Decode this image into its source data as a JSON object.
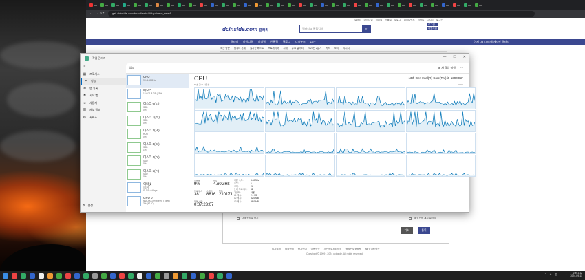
{
  "browser": {
    "url": "gall.dcinside.com/board/write/?id=pridepc_new4",
    "tab_colors": [
      "#e33",
      "#4a4",
      "#3a6",
      "#2a8",
      "#4a4",
      "#3a6",
      "#d84",
      "#4a4",
      "#2a6",
      "#4a4",
      "#e44",
      "#36c",
      "#3a6",
      "#4a4",
      "#36c",
      "#e93",
      "#4a4",
      "#3a6",
      "#4a4",
      "#e44",
      "#3a6",
      "#36c",
      "#4a4",
      "#3a6",
      "#e44",
      "#4a4",
      "#36c",
      "#3a6",
      "#4a4",
      "#e44",
      "#3a6",
      "#4a4",
      "#36c",
      "#e44",
      "#3a6",
      "#4a4"
    ]
  },
  "dc": {
    "logo": "dcinside.com",
    "logo_sub": "갤러리",
    "search_placeholder": "갤러리 & 통합검색",
    "search_icon": "search-icon",
    "toplinks": [
      "갤러리",
      "마이너갤",
      "미니갤",
      "인물갤",
      "갤로그",
      "디시트렌드",
      "이벤트",
      "디시콘",
      "로그인"
    ],
    "login_buttons": [
      "로그인",
      "회원가입"
    ],
    "nav": [
      "갤러리",
      "마이너갤",
      "미니갤",
      "인물갤",
      "갤로그",
      "디시뉴스",
      "NFT"
    ],
    "nav_right": "이제 Q3 LIVE에 게시판 갤러리",
    "subnav": [
      "최근 방문",
      "컴퓨터 본체",
      "실시간 베스트",
      "프로게이머",
      "시대",
      "주요 갤러리",
      "2025년 2분기",
      "카드",
      "소리",
      "리니지"
    ],
    "form_option": "나의 작성글 보기",
    "form_nft": "NFT 인정 게시 갤러리",
    "btn_cancel": "취소",
    "btn_submit": "등록",
    "footer_links": [
      "회사소개",
      "제휴안내",
      "광고안내",
      "이용약관",
      "개인정보처리방침",
      "청소년보호정책",
      "NFT 이용약관"
    ],
    "copyright": "Copyright © 1999 - 2024 dcinside. All rights reserved."
  },
  "taskmgr": {
    "title": "작업 관리자",
    "page_head": "성능",
    "run_task": "새 작업 실행",
    "window_buttons": [
      "—",
      "☐",
      "✕"
    ],
    "sidebar": [
      {
        "icon": "≡",
        "label": ""
      },
      {
        "icon": "▦",
        "label": "프로세스"
      },
      {
        "icon": "⌁",
        "label": "성능"
      },
      {
        "icon": "⟲",
        "label": "앱 기록"
      },
      {
        "icon": "⚑",
        "label": "시작 앱"
      },
      {
        "icon": "☺",
        "label": "사용자"
      },
      {
        "icon": "☰",
        "label": "세부 정보"
      },
      {
        "icon": "⚙",
        "label": "서비스"
      }
    ],
    "settings_label": "설정",
    "devices": [
      {
        "name": "CPU",
        "l1": "9% 4.60GHz",
        "l2": ""
      },
      {
        "name": "메모리",
        "l1": "13.6/31.8 GB (43%)",
        "l2": ""
      },
      {
        "name": "디스크 0(E:)",
        "l1": "SSD",
        "l2": "0%"
      },
      {
        "name": "디스크 1(G:)",
        "l1": "SSD",
        "l2": "0%"
      },
      {
        "name": "디스크 2(H:)",
        "l1": "HDD",
        "l2": "0%"
      },
      {
        "name": "디스크 3(C:)",
        "l1": "SSD",
        "l2": "1%"
      },
      {
        "name": "디스크 4(D:)",
        "l1": "SSD",
        "l2": "0%"
      },
      {
        "name": "디스크 5(F:)",
        "l1": "SSD",
        "l2": "0%"
      },
      {
        "name": "이더넷",
        "l1": "이더넷",
        "l2": "S: 0 R: 0 Kbps"
      },
      {
        "name": "GPU 0",
        "l1": "NVIDIA GeForce RTX 4090",
        "l2": "3% (47 °C)"
      }
    ],
    "cpu": {
      "title": "CPU",
      "model": "13th Gen Intel(R) Core(TM) i9-13900KF",
      "sub": "60초 간 % 사용률",
      "pct": "100%",
      "utilization_label": "이용률",
      "utilization": "9%",
      "speed_label": "속도",
      "speed": "4.60GHz",
      "processes_label": "프로세스",
      "processes": "381",
      "threads_label": "스레드",
      "threads": "8816",
      "handles_label": "핸들",
      "handles": "210171",
      "uptime_label": "작동 시간",
      "uptime": "0:07:23:07",
      "details": [
        {
          "k": "기본 속도:",
          "v": "3.00GHz"
        },
        {
          "k": "소켓:",
          "v": "1"
        },
        {
          "k": "코어:",
          "v": "24"
        },
        {
          "k": "논리 프로세서:",
          "v": "32"
        },
        {
          "k": "가상화:",
          "v": "사용"
        },
        {
          "k": "L1 캐시:",
          "v": "2.1 MB"
        },
        {
          "k": "L2 캐시:",
          "v": "32.0 MB"
        },
        {
          "k": "L3 캐시:",
          "v": "36.0 MB"
        }
      ],
      "core_loads": [
        0.55,
        0.35,
        0.25,
        0.3,
        0.7,
        0.5,
        0.4,
        0.45,
        0.15,
        0.1,
        0.1,
        0.08,
        0.06,
        0.05,
        0.05,
        0.05
      ]
    }
  },
  "taskbar": {
    "app_colors": [
      "#e44",
      "#3a6",
      "#36c",
      "#eee",
      "#e93",
      "#4a4",
      "#e44",
      "#36c",
      "#3a6",
      "#999",
      "#4a4",
      "#36c",
      "#e44",
      "#3a6",
      "#eee",
      "#36c",
      "#4a4",
      "#999",
      "#e93",
      "#3a6",
      "#36c",
      "#4a4",
      "#e44",
      "#3a6",
      "#36c"
    ],
    "lang": "A",
    "lang2": "한",
    "time": "오후 1:12",
    "date": "2024-09-11"
  }
}
